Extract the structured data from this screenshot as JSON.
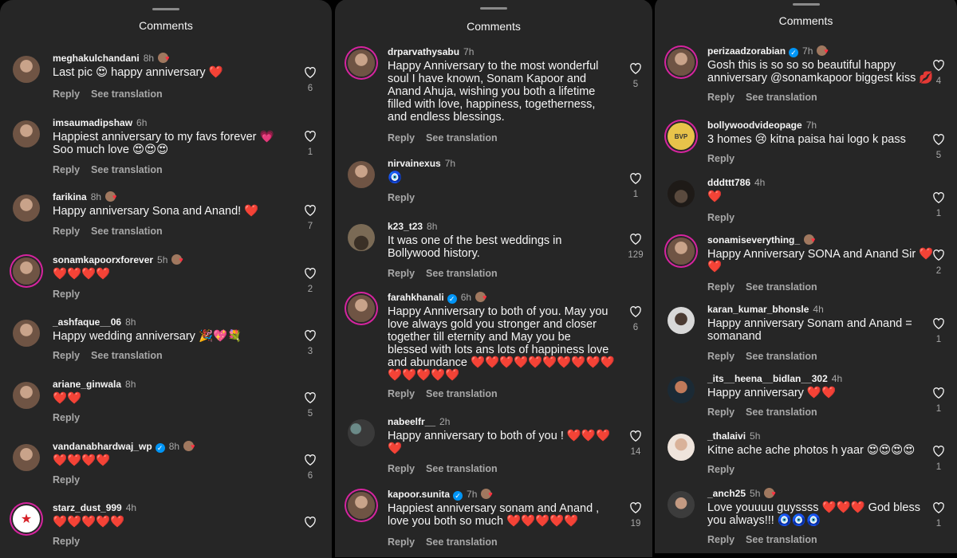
{
  "panel_title": "Comments",
  "reply_label": "Reply",
  "translate_label": "See translation",
  "panels": [
    {
      "comments": [
        {
          "user": "meghakulchandani",
          "time": "8h",
          "text": "Last pic 😍 happy anniversary ❤️",
          "likes": "6"
        },
        {
          "user": "imsaumadipshaw",
          "time": "6h",
          "text": "Happiest anniversary to my favs forever 💗\nSoo much love 😍😍😍",
          "likes": "1"
        },
        {
          "user": "farikina",
          "time": "8h",
          "text": "Happy anniversary Sona and Anand! ❤️",
          "likes": "7"
        },
        {
          "user": "sonamkapoorxforever",
          "time": "5h",
          "text": "❤️❤️❤️❤️",
          "likes": "2"
        },
        {
          "user": "_ashfaque__06",
          "time": "8h",
          "text": "Happy wedding anniversary 🎉💖💐",
          "likes": "3"
        },
        {
          "user": "ariane_ginwala",
          "time": "8h",
          "text": "❤️❤️",
          "likes": "5"
        },
        {
          "user": "vandanabhardwaj_wp",
          "time": "8h",
          "text": "❤️❤️❤️❤️",
          "likes": "6"
        },
        {
          "user": "starz_dust_999",
          "time": "4h",
          "text": "❤️❤️❤️❤️❤️",
          "likes": ""
        }
      ]
    },
    {
      "comments": [
        {
          "user": "drparvathysabu",
          "time": "7h",
          "text": "Happy Anniversary to the most wonderful\nsoul I have known, Sonam Kapoor and\nAnand Ahuja, wishing you both a lifetime\nfilled with love, happiness, togetherness,\nand endless blessings.",
          "likes": "5"
        },
        {
          "user": "nirvainexus",
          "time": "7h",
          "text": "🧿",
          "likes": "1"
        },
        {
          "user": "k23_t23",
          "time": "8h",
          "text": "It was one of the best weddings in\nBollywood history.",
          "likes": "129"
        },
        {
          "user": "farahkhanali",
          "time": "6h",
          "text": "Happy Anniversary to both of you. May you\nlove always gold you stronger and closer\ntogether till eternity and May you be\nblessed with lots ans lots of happiness love\nand abundance ❤️❤️❤️❤️❤️❤️❤️❤️❤️❤️\n❤️❤️❤️❤️❤️",
          "likes": "6"
        },
        {
          "user": "nabeelfr__",
          "time": "2h",
          "text": "Happy anniversary to both of you ! ❤️❤️❤️\n❤️",
          "likes": "14"
        },
        {
          "user": "kapoor.sunita",
          "time": "7h",
          "text": "Happiest anniversary sonam and Anand ,\nlove you both so much ❤️❤️❤️❤️❤️",
          "likes": "19"
        }
      ]
    },
    {
      "comments": [
        {
          "user": "perizaadzorabian",
          "time": "7h",
          "text": "Gosh this is so so so beautiful happy\nanniversary @sonamkapoor biggest kiss 💋",
          "likes": "4"
        },
        {
          "user": "bollywoodvideopage",
          "time": "7h",
          "text": "3 homes 😢 kitna paisa hai logo k pass",
          "likes": "5"
        },
        {
          "user": "dddttt786",
          "time": "4h",
          "text": "❤️",
          "likes": "1"
        },
        {
          "user": "sonamiseverything_",
          "time": "5h",
          "text": "Happy Anniversary SONA and Anand Sir ❤️\n❤️",
          "likes": "2"
        },
        {
          "user": "karan_kumar_bhonsle",
          "time": "4h",
          "text": "Happy anniversary Sonam and Anand =\nsomanand",
          "likes": "1"
        },
        {
          "user": "_its__heena__bidlan__302",
          "time": "4h",
          "text": "Happy anniversary ❤️❤️",
          "likes": "1"
        },
        {
          "user": "_thalaivi",
          "time": "5h",
          "text": "Kitne ache ache photos h yaar 😍😍😍😍",
          "likes": "1"
        },
        {
          "user": "_anch25",
          "time": "5h",
          "text": "Love youuuu guyssss ❤️❤️❤️ God bless\nyou always!!! 🧿🧿🧿",
          "likes": "1"
        }
      ]
    }
  ]
}
